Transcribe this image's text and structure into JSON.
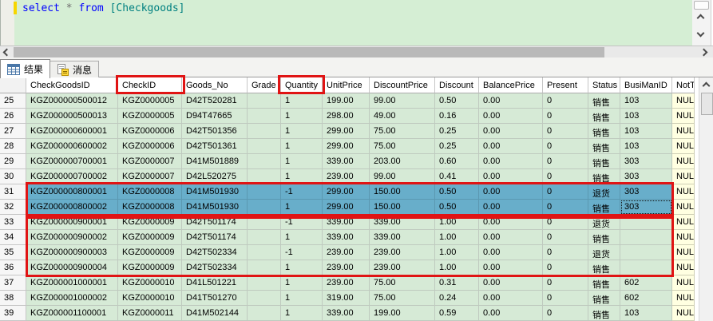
{
  "editor": {
    "code_tokens": [
      {
        "type": "keyword",
        "text": "select "
      },
      {
        "type": "operator",
        "text": "* "
      },
      {
        "type": "keyword",
        "text": "from "
      },
      {
        "type": "identifier",
        "text": "[Checkgoods]"
      }
    ]
  },
  "tabs": [
    {
      "label": "结果",
      "active": true
    },
    {
      "label": "消息",
      "active": false
    }
  ],
  "grid": {
    "columns": [
      "CheckGoodsID",
      "CheckID",
      "Goods_No",
      "Grade",
      "Quantity",
      "UnitPrice",
      "DiscountPrice",
      "Discount",
      "BalancePrice",
      "Present",
      "Status",
      "BusiManID",
      "NotT"
    ],
    "rows": [
      {
        "num": "25",
        "selected": false,
        "cells": [
          "KGZ000000500012",
          "KGZ0000005",
          "D42T520281",
          "",
          "1",
          "199.00",
          "99.00",
          "0.50",
          "0.00",
          "0",
          "销售",
          "103",
          "NULL"
        ]
      },
      {
        "num": "26",
        "selected": false,
        "cells": [
          "KGZ000000500013",
          "KGZ0000005",
          "D94T47665",
          "",
          "1",
          "298.00",
          "49.00",
          "0.16",
          "0.00",
          "0",
          "销售",
          "103",
          "NULL"
        ]
      },
      {
        "num": "27",
        "selected": false,
        "cells": [
          "KGZ000000600001",
          "KGZ0000006",
          "D42T501356",
          "",
          "1",
          "299.00",
          "75.00",
          "0.25",
          "0.00",
          "0",
          "销售",
          "103",
          "NULL"
        ]
      },
      {
        "num": "28",
        "selected": false,
        "cells": [
          "KGZ000000600002",
          "KGZ0000006",
          "D42T501361",
          "",
          "1",
          "299.00",
          "75.00",
          "0.25",
          "0.00",
          "0",
          "销售",
          "103",
          "NULL"
        ]
      },
      {
        "num": "29",
        "selected": false,
        "cells": [
          "KGZ000000700001",
          "KGZ0000007",
          "D41M501889",
          "",
          "1",
          "339.00",
          "203.00",
          "0.60",
          "0.00",
          "0",
          "销售",
          "303",
          "NULL"
        ]
      },
      {
        "num": "30",
        "selected": false,
        "cells": [
          "KGZ000000700002",
          "KGZ0000007",
          "D42L520275",
          "",
          "1",
          "239.00",
          "99.00",
          "0.41",
          "0.00",
          "0",
          "销售",
          "303",
          "NULL"
        ]
      },
      {
        "num": "31",
        "selected": true,
        "cells": [
          "KGZ000000800001",
          "KGZ0000008",
          "D41M501930",
          "",
          "-1",
          "299.00",
          "150.00",
          "0.50",
          "0.00",
          "0",
          "退货",
          "303",
          "NULL"
        ]
      },
      {
        "num": "32",
        "selected": true,
        "cells": [
          "KGZ000000800002",
          "KGZ0000008",
          "D41M501930",
          "",
          "1",
          "299.00",
          "150.00",
          "0.50",
          "0.00",
          "0",
          "销售",
          "303",
          "NULL"
        ]
      },
      {
        "num": "33",
        "selected": false,
        "cells": [
          "KGZ000000900001",
          "KGZ0000009",
          "D42T501174",
          "",
          "-1",
          "339.00",
          "339.00",
          "1.00",
          "0.00",
          "0",
          "退货",
          "",
          "NULL"
        ]
      },
      {
        "num": "34",
        "selected": false,
        "cells": [
          "KGZ000000900002",
          "KGZ0000009",
          "D42T501174",
          "",
          "1",
          "339.00",
          "339.00",
          "1.00",
          "0.00",
          "0",
          "销售",
          "",
          "NULL"
        ]
      },
      {
        "num": "35",
        "selected": false,
        "cells": [
          "KGZ000000900003",
          "KGZ0000009",
          "D42T502334",
          "",
          "-1",
          "239.00",
          "239.00",
          "1.00",
          "0.00",
          "0",
          "退货",
          "",
          "NULL"
        ]
      },
      {
        "num": "36",
        "selected": false,
        "cells": [
          "KGZ000000900004",
          "KGZ0000009",
          "D42T502334",
          "",
          "1",
          "239.00",
          "239.00",
          "1.00",
          "0.00",
          "0",
          "销售",
          "",
          "NULL"
        ]
      },
      {
        "num": "37",
        "selected": false,
        "cells": [
          "KGZ000001000001",
          "KGZ0000010",
          "D41L501221",
          "",
          "1",
          "239.00",
          "75.00",
          "0.31",
          "0.00",
          "0",
          "销售",
          "602",
          "NULL"
        ]
      },
      {
        "num": "38",
        "selected": false,
        "cells": [
          "KGZ000001000002",
          "KGZ0000010",
          "D41T501270",
          "",
          "1",
          "319.00",
          "75.00",
          "0.24",
          "0.00",
          "0",
          "销售",
          "602",
          "NULL"
        ]
      },
      {
        "num": "39",
        "selected": false,
        "cells": [
          "KGZ000001100001",
          "KGZ0000011",
          "D41M502144",
          "",
          "1",
          "339.00",
          "199.00",
          "0.59",
          "0.00",
          "0",
          "销售",
          "103",
          "NULL"
        ]
      }
    ],
    "selected_row_nums": [
      "31",
      "32"
    ],
    "focused_cell": {
      "row_num": "32",
      "column": "BusiManID"
    }
  },
  "annotations": {
    "boxes": [
      "checkid-column-header",
      "quantity-column-header",
      "rows-31-32",
      "rows-33-36"
    ]
  },
  "colors": {
    "editor_background": "#d5eed4",
    "grid_row_background": "#d6ead6",
    "selection_background": "#68aeca",
    "null_cell_background": "#ffffe1",
    "sql_keyword": "#0000ff",
    "sql_identifier": "#008080",
    "annotation_red": "#e01414",
    "change_bar_yellow": "#f6d600"
  }
}
